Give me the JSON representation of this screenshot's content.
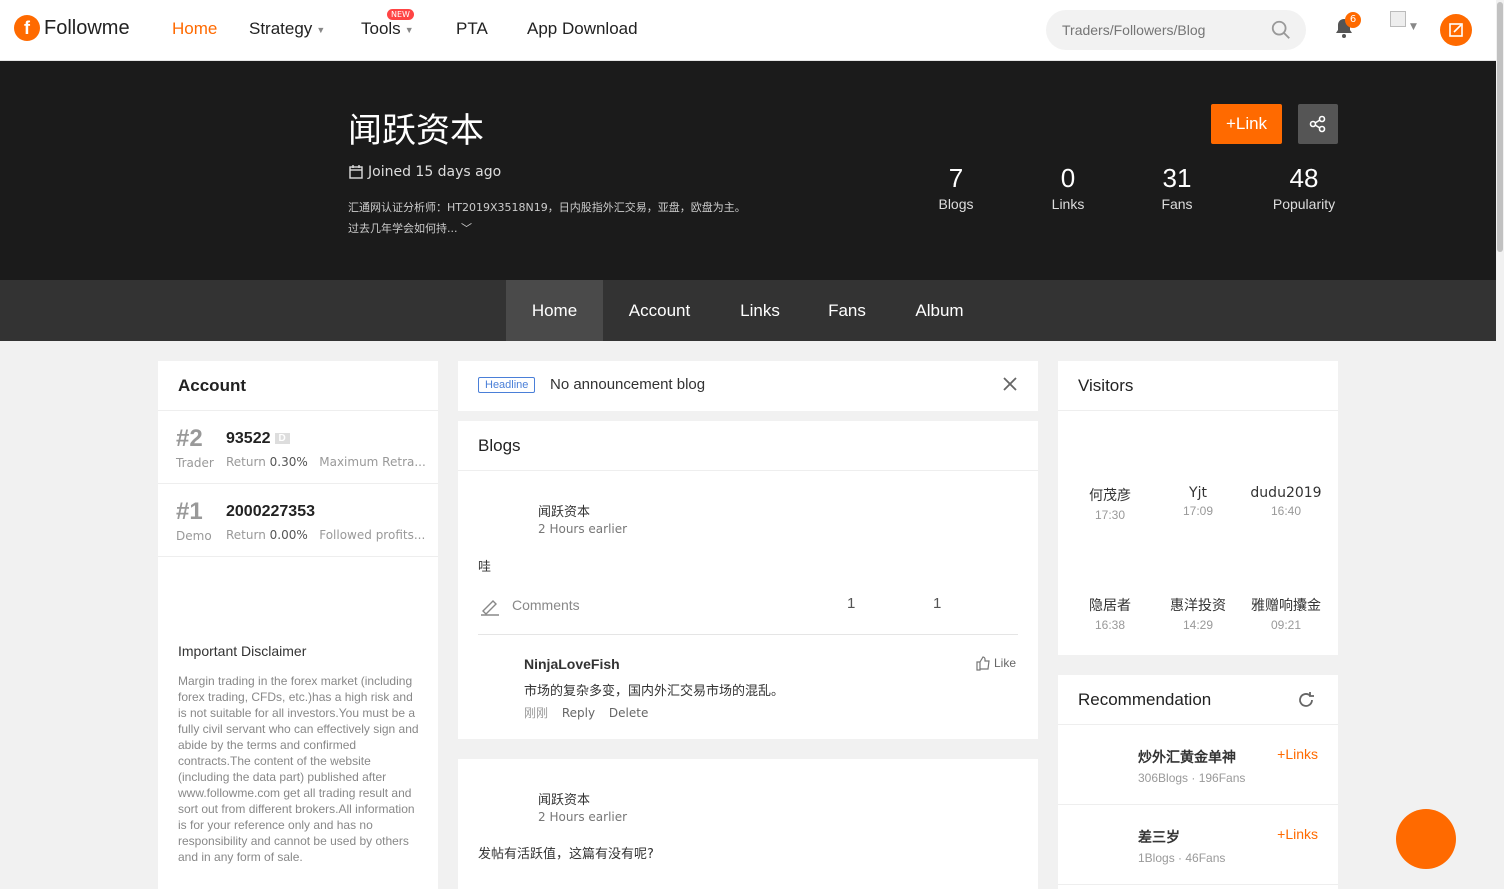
{
  "header": {
    "logo_text": "Followme",
    "nav": [
      {
        "label": "Home"
      },
      {
        "label": "Strategy"
      },
      {
        "label": "Tools",
        "badge": "NEW"
      },
      {
        "label": "PTA"
      },
      {
        "label": "App Download"
      }
    ],
    "search_placeholder": "Traders/Followers/Blog",
    "notification_count": "6",
    "accent_color": "#ff6a00"
  },
  "profile": {
    "name": "闻跃资本",
    "joined": "Joined 15 days ago",
    "intro_line1": "汇通网认证分析师：HT2019X3518N19，日内股指外汇交易，亚盘，欧盘为主。",
    "intro_line2": "过去几年学会如何持...",
    "link_button": "+Link",
    "stats": [
      {
        "value": "7",
        "label": "Blogs"
      },
      {
        "value": "0",
        "label": "Links"
      },
      {
        "value": "31",
        "label": "Fans"
      },
      {
        "value": "48",
        "label": "Popularity"
      }
    ]
  },
  "subnav": [
    {
      "label": "Home"
    },
    {
      "label": "Account"
    },
    {
      "label": "Links"
    },
    {
      "label": "Fans"
    },
    {
      "label": "Album"
    }
  ],
  "account": {
    "title": "Account",
    "items": [
      {
        "rank": "#2",
        "type": "Trader",
        "number": "93522",
        "tag": "D",
        "return_label": "Return",
        "return_value": "0.30%",
        "extra": "Maximum Retra..."
      },
      {
        "rank": "#1",
        "type": "Demo",
        "number": "2000227353",
        "return_label": "Return",
        "return_value": "0.00%",
        "extra": "Followed profits..."
      }
    ],
    "disclaimer_title": "Important Disclaimer",
    "disclaimer_body": "Margin trading in the forex market (including forex trading, CFDs, etc.)has a high risk and is not suitable for all investors.You must be a fully civil servant who can effectively sign and abide by the terms and confirmed contracts.The content of the website (including the data part) published after www.followme.com get all trading result and sort out from different brokers.All information is for your reference only and has no responsibility and cannot be used by others and in any form of sale."
  },
  "headline": {
    "tag": "Headline",
    "text": "No announcement blog"
  },
  "blogs": {
    "title": "Blogs",
    "posts": [
      {
        "author": "闻跃资本",
        "time": "2 Hours earlier",
        "body": "哇",
        "comments_label": "Comments",
        "count_a": "1",
        "count_b": "1",
        "comment": {
          "user": "NinjaLoveFish",
          "text": "市场的复杂多变，国内外汇交易市场的混乱。",
          "time": "刚刚",
          "reply": "Reply",
          "delete": "Delete",
          "like": "Like"
        }
      },
      {
        "author": "闻跃资本",
        "time": "2 Hours earlier",
        "body": "发帖有活跃值，这篇有没有呢?"
      }
    ]
  },
  "visitors": {
    "title": "Visitors",
    "items": [
      {
        "name": "何茂彦",
        "time": "17:30"
      },
      {
        "name": "Yjt",
        "time": "17:09"
      },
      {
        "name": "dudu2019",
        "time": "16:40"
      },
      {
        "name": "隐居者",
        "time": "16:38"
      },
      {
        "name": "惠洋投资",
        "time": "14:29"
      },
      {
        "name": "雅赠响攮金",
        "time": "09:21"
      }
    ]
  },
  "recommendation": {
    "title": "Recommendation",
    "items": [
      {
        "name": "炒外汇黄金单神",
        "meta": "306Blogs · 196Fans",
        "link": "+Links"
      },
      {
        "name": "差三岁",
        "meta": "1Blogs · 46Fans",
        "link": "+Links"
      }
    ]
  }
}
